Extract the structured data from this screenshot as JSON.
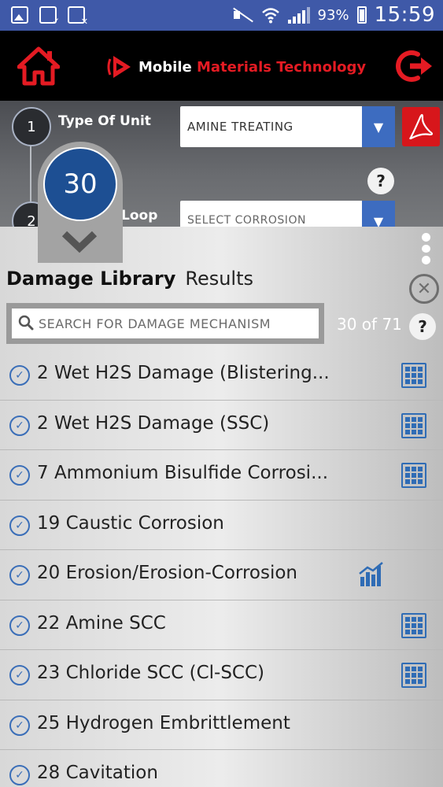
{
  "status_bar": {
    "battery": "93%",
    "time": "15:59"
  },
  "header": {
    "brand_part1": "Mobile",
    "brand_part2": "Materials Technology",
    "colors": {
      "brand_red": "#e41b23",
      "header_bg": "#000000"
    }
  },
  "form": {
    "step1": {
      "number": "1",
      "label": "Type Of Unit",
      "selected": "AMINE TREATING"
    },
    "step2": {
      "number": "2",
      "label": "n Loop",
      "selected": "SELECT CORROSION"
    }
  },
  "overlay_badge": {
    "count": "30"
  },
  "panel": {
    "title": "Damage Library",
    "tab_results": "Results",
    "search_placeholder": "SEARCH FOR DAMAGE MECHANISM",
    "count_text": "30 of 71",
    "help": "?",
    "close": "✕"
  },
  "damage_list": [
    {
      "name": "2 Wet H2S Damage (Blistering...",
      "icon": "grid-icon"
    },
    {
      "name": "2 Wet H2S Damage (SSC)",
      "icon": "grid-icon"
    },
    {
      "name": "7 Ammonium Bisulfide Corrosi...",
      "icon": "grid-icon"
    },
    {
      "name": "19 Caustic Corrosion",
      "icon": ""
    },
    {
      "name": "20 Erosion/Erosion-Corrosion",
      "icon": "chart-icon"
    },
    {
      "name": "22 Amine SCC",
      "icon": "grid-icon"
    },
    {
      "name": "23 Chloride SCC (Cl-SCC)",
      "icon": "grid-icon"
    },
    {
      "name": "25 Hydrogen Embrittlement",
      "icon": ""
    },
    {
      "name": "28 Cavitation",
      "icon": ""
    }
  ]
}
